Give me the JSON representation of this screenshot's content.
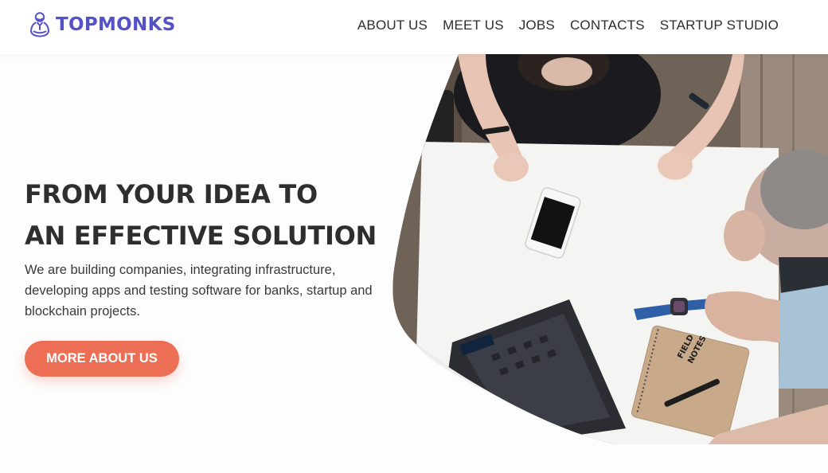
{
  "brand": {
    "name": "TOPMONKS",
    "color": "#5452c6"
  },
  "nav": {
    "items": [
      "ABOUT US",
      "MEET US",
      "JOBS",
      "CONTACTS",
      "STARTUP STUDIO"
    ]
  },
  "hero": {
    "headline_line1": "FROM YOUR IDEA TO",
    "headline_line2": "AN EFFECTIVE SOLUTION",
    "description": "We are building companies, integrating infrastructure, developing apps and testing software for banks, startup and blockchain projects.",
    "cta_label": "MORE ABOUT US",
    "cta_color": "#ec6f55",
    "photo_notebook_text_1": "FIELD",
    "photo_notebook_text_2": "NOTES"
  }
}
